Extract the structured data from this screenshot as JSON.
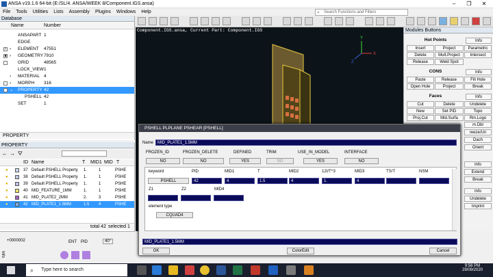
{
  "window": {
    "title": "ANSA v19.1.6 64-bit (E:/SL/4. ANSA/WEEK 8/Component.IGS.ansa)"
  },
  "menu": [
    "File",
    "Tools",
    "Utilities",
    "Lists",
    "Assembly",
    "Plugins",
    "Windows",
    "Help"
  ],
  "search": {
    "placeholder": "Search Functions and Filters"
  },
  "database": {
    "title": "Database",
    "col_name": "Name",
    "col_number": "Number",
    "rows": [
      {
        "name": "ANSAPART",
        "number": "1"
      },
      {
        "name": "EDGE",
        "number": ""
      },
      {
        "name": "ELEMENT",
        "number": "47551"
      },
      {
        "name": "GEOMETRY",
        "number": "7910"
      },
      {
        "name": "GRID",
        "number": "48565"
      },
      {
        "name": "LOCK_VIEW",
        "number": "1"
      },
      {
        "name": "MATERIAL",
        "number": "4"
      },
      {
        "name": "MORPH",
        "number": "316"
      },
      {
        "name": "PROPERTY",
        "number": "42"
      },
      {
        "name": "PSHELL",
        "number": "42"
      },
      {
        "name": "SET",
        "number": "1"
      }
    ],
    "footer": "PROPERTY"
  },
  "property": {
    "title": "PROPERTY",
    "cols": [
      "ID",
      "Name",
      "T",
      "MID1",
      "MID",
      "T"
    ],
    "rows": [
      {
        "id": "37",
        "name": "Default PSHELL Property",
        "t": "1.",
        "mid1": "1",
        "type": "PSHE",
        "color": "#c8d8f0"
      },
      {
        "id": "38",
        "name": "Default PSHELL Property",
        "t": "1.",
        "mid1": "1",
        "type": "PSHE",
        "color": "#c0c8e0"
      },
      {
        "id": "39",
        "name": "Default PSHELL Property",
        "t": "1.",
        "mid1": "1",
        "type": "PSHE",
        "color": "#c0c0e8"
      },
      {
        "id": "40",
        "name": "MID_FEATURE_1MM",
        "t": "1.",
        "mid1": "1",
        "type": "PSHE",
        "color": "#e8e070"
      },
      {
        "id": "41",
        "name": "MID_PLATE2_2MM",
        "t": "2.",
        "mid1": "3",
        "type": "PSHE",
        "color": "#a060c0"
      },
      {
        "id": "42",
        "name": "MID_PLATE1_1.5MM",
        "t": "1.5",
        "mid1": "4",
        "type": "PSHE",
        "color": "#80b0e8"
      }
    ],
    "status_total": "total 42",
    "status_selected": "selected 1"
  },
  "bottom": {
    "field1": "+0000002"
  },
  "viewport": {
    "header": "Component.IGS.ansa,  Current Part: Component.IGS"
  },
  "modules": {
    "title": "Modules Buttons",
    "hot_points": "Hot Points",
    "cons": "CONS",
    "faces": "Faces",
    "info": "Info",
    "hp_buttons": [
      "Insert",
      "Project",
      "Parametric",
      "Delete",
      "Mult.Project",
      "Intersect",
      "Release",
      "Weld Spot"
    ],
    "cons_buttons": [
      "Paste",
      "Release",
      "Fill Hole",
      "Open Hole",
      "Project",
      "Break"
    ],
    "faces_buttons": [
      "Cut",
      "Delete",
      "Undelete",
      "New",
      "Set PID",
      "Topo",
      "Proj.Cut",
      "Mid.Surfa",
      "Rm.Logo"
    ],
    "side_labels": [
      "m.Dbl",
      "reeze/Un",
      "Dach",
      "Orient"
    ],
    "lower_buttons": [
      "Info",
      "Extend",
      "Break",
      "Info",
      "Undelete",
      "Imprint"
    ]
  },
  "dialog": {
    "title": "PSHELL PLPLANE PSHEAR [PSHELL]",
    "name_label": "Name",
    "name_value": "MID_PLATE1_1.5MM",
    "flags": [
      {
        "label": "FROZEN_ID",
        "value": "NO"
      },
      {
        "label": "FROZEN_DELETE",
        "value": "NO"
      },
      {
        "label": "DEFINED",
        "value": "YES"
      },
      {
        "label": "TRIM",
        "value": "NO"
      },
      {
        "label": "USE_IN_MODEL",
        "value": "YES"
      },
      {
        "label": "INTERFACE",
        "value": "NO"
      }
    ],
    "cols": [
      "keyword",
      "PID",
      "MID1",
      "T",
      "MID2",
      "12I/T^3",
      "MID3",
      "TS/T",
      "NSM"
    ],
    "values": [
      "PSHELL",
      "42",
      "4",
      "1.5",
      "4",
      "1.",
      "4",
      "",
      ""
    ],
    "row2_labels": [
      "Z1",
      "Z2",
      "MID4"
    ],
    "element_type_label": "element type",
    "element_type_value": "CQUAD4",
    "footer_name": "MID_PLATE1_1.5MM",
    "ok": "OK",
    "coloredit": "ColorEdit",
    "cancel": "Cancel"
  },
  "taskbar": {
    "search": "Type here to search",
    "time": "9:56 PM",
    "date": "29/09/2020"
  }
}
